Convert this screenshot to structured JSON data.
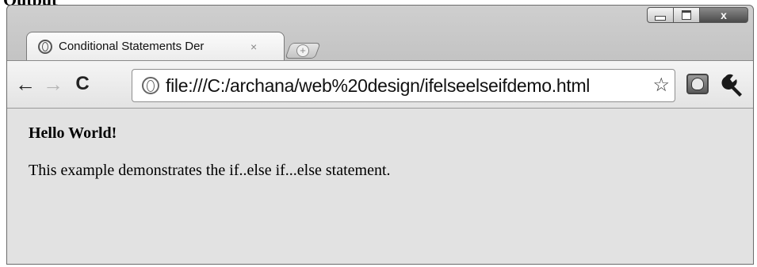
{
  "window": {
    "controls": {
      "minimize": "minimize",
      "maximize": "maximize",
      "close": "x"
    }
  },
  "tab": {
    "title": "Conditional Statements Der",
    "close_glyph": "×",
    "icon": "globe-icon"
  },
  "new_tab": {
    "glyph": "+",
    "icon": "new-tab-icon"
  },
  "toolbar": {
    "back_glyph": "←",
    "forward_glyph": "→",
    "reload_glyph": "C",
    "url": "file:///C:/archana/web%20design/ifelseelseifdemo.html",
    "star_glyph": "☆",
    "extension_icon": "shield-icon",
    "menu_icon": "wrench-icon"
  },
  "page": {
    "heading": "Hello World!",
    "paragraph": "This example demonstrates the if..else if...else statement."
  },
  "colors": {
    "frame": "#b9b9b9",
    "toolbar": "#e9e9e9",
    "content_bg": "#e2e2e2",
    "text": "#000000"
  }
}
